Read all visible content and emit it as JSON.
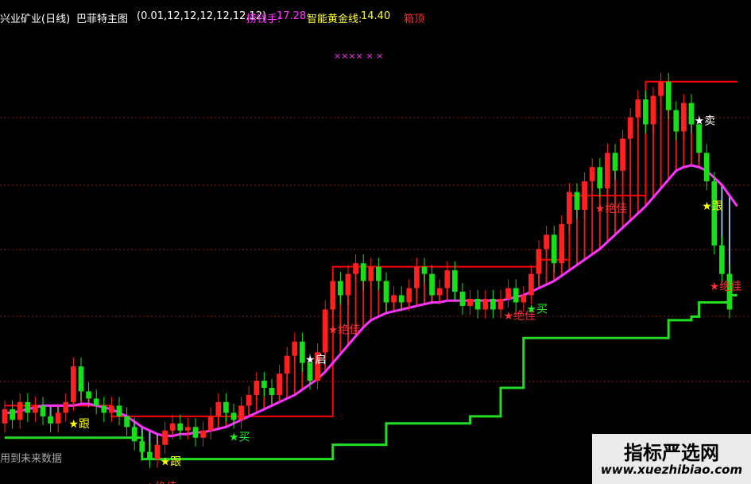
{
  "header": {
    "stock_name": "兴业矿业(日线)",
    "indicator": "巴菲特主图",
    "params": "(0.01,12,12,12,12,12,12)",
    "money_label": "捞钱手:",
    "money_value": "17.28",
    "gold_label": "智能黄金线:",
    "gold_value": "14.40",
    "box_label": "箱顶",
    "marks": "××××  ×      ×"
  },
  "signals": {
    "follow": "★跟",
    "buy": "★买",
    "sell": "★卖",
    "best": "★绝佳",
    "start": "★启"
  },
  "footer_note": "用到未来数据",
  "watermark": {
    "title": "指标严选网",
    "url": "www.xuezhibiao.com"
  },
  "colors": {
    "up": "#ff2020",
    "down": "#18e018",
    "resistance": "#ff0000",
    "support": "#22dd22",
    "trend": "#ff33ff",
    "fill_up": "#ff2020",
    "fill_down": "#9fd6ff",
    "signal_white": "#ffffff",
    "signal_yellow": "#ffff00",
    "signal_red": "#ff3030",
    "signal_green": "#22ee22",
    "signal_magenta": "#ff33ff",
    "header_text": "#ffffff",
    "header_red": "#ff2a2a",
    "header_magenta": "#ff33ff",
    "header_yellow": "#ffff33"
  },
  "chart_data": {
    "type": "candlestick",
    "title": "兴业矿业(日线) 巴菲特主图",
    "grid": true,
    "candles": [
      {
        "o": 8.0,
        "c": 8.4
      },
      {
        "o": 8.4,
        "c": 8.1
      },
      {
        "o": 8.1,
        "c": 8.6
      },
      {
        "o": 8.6,
        "c": 8.3
      },
      {
        "o": 8.3,
        "c": 8.5
      },
      {
        "o": 8.5,
        "c": 8.2
      },
      {
        "o": 8.2,
        "c": 8.0
      },
      {
        "o": 8.0,
        "c": 8.3
      },
      {
        "o": 8.3,
        "c": 8.6
      },
      {
        "o": 8.6,
        "c": 9.6
      },
      {
        "o": 9.6,
        "c": 8.9
      },
      {
        "o": 8.9,
        "c": 8.7
      },
      {
        "o": 8.7,
        "c": 8.5
      },
      {
        "o": 8.5,
        "c": 8.3
      },
      {
        "o": 8.3,
        "c": 8.5
      },
      {
        "o": 8.5,
        "c": 8.2
      },
      {
        "o": 8.2,
        "c": 7.9
      },
      {
        "o": 7.9,
        "c": 7.5
      },
      {
        "o": 7.5,
        "c": 7.2
      },
      {
        "o": 7.2,
        "c": 7.0
      },
      {
        "o": 7.0,
        "c": 7.4
      },
      {
        "o": 7.4,
        "c": 7.8
      },
      {
        "o": 7.8,
        "c": 8.0
      },
      {
        "o": 8.0,
        "c": 7.8
      },
      {
        "o": 7.8,
        "c": 7.9
      },
      {
        "o": 7.9,
        "c": 7.6
      },
      {
        "o": 7.6,
        "c": 7.8
      },
      {
        "o": 7.8,
        "c": 8.2
      },
      {
        "o": 8.2,
        "c": 8.6
      },
      {
        "o": 8.6,
        "c": 8.3
      },
      {
        "o": 8.3,
        "c": 8.1
      },
      {
        "o": 8.1,
        "c": 8.5
      },
      {
        "o": 8.5,
        "c": 8.8
      },
      {
        "o": 8.8,
        "c": 9.2
      },
      {
        "o": 9.2,
        "c": 9.0
      },
      {
        "o": 9.0,
        "c": 8.8
      },
      {
        "o": 8.8,
        "c": 9.4
      },
      {
        "o": 9.4,
        "c": 9.9
      },
      {
        "o": 9.9,
        "c": 10.3
      },
      {
        "o": 10.3,
        "c": 9.7
      },
      {
        "o": 9.7,
        "c": 9.2
      },
      {
        "o": 9.2,
        "c": 10.0
      },
      {
        "o": 10.0,
        "c": 11.2
      },
      {
        "o": 11.2,
        "c": 12.0
      },
      {
        "o": 12.0,
        "c": 11.6
      },
      {
        "o": 11.6,
        "c": 12.2
      },
      {
        "o": 12.2,
        "c": 12.5
      },
      {
        "o": 12.5,
        "c": 12.0
      },
      {
        "o": 12.0,
        "c": 12.4
      },
      {
        "o": 12.4,
        "c": 12.0
      },
      {
        "o": 12.0,
        "c": 11.4
      },
      {
        "o": 11.4,
        "c": 11.6
      },
      {
        "o": 11.6,
        "c": 11.4
      },
      {
        "o": 11.4,
        "c": 11.8
      },
      {
        "o": 11.8,
        "c": 12.4
      },
      {
        "o": 12.4,
        "c": 12.2
      },
      {
        "o": 12.2,
        "c": 11.6
      },
      {
        "o": 11.6,
        "c": 11.8
      },
      {
        "o": 11.8,
        "c": 12.3
      },
      {
        "o": 12.3,
        "c": 11.7
      },
      {
        "o": 11.7,
        "c": 11.3
      },
      {
        "o": 11.3,
        "c": 11.5
      },
      {
        "o": 11.5,
        "c": 11.2
      },
      {
        "o": 11.2,
        "c": 11.5
      },
      {
        "o": 11.5,
        "c": 11.2
      },
      {
        "o": 11.2,
        "c": 11.5
      },
      {
        "o": 11.5,
        "c": 11.8
      },
      {
        "o": 11.8,
        "c": 11.4
      },
      {
        "o": 11.4,
        "c": 11.6
      },
      {
        "o": 11.6,
        "c": 12.2
      },
      {
        "o": 12.2,
        "c": 12.9
      },
      {
        "o": 12.9,
        "c": 13.3
      },
      {
        "o": 13.3,
        "c": 12.5
      },
      {
        "o": 12.5,
        "c": 13.6
      },
      {
        "o": 13.6,
        "c": 14.5
      },
      {
        "o": 14.5,
        "c": 14.0
      },
      {
        "o": 14.0,
        "c": 14.8
      },
      {
        "o": 14.8,
        "c": 15.2
      },
      {
        "o": 15.2,
        "c": 14.6
      },
      {
        "o": 14.6,
        "c": 15.6
      },
      {
        "o": 15.6,
        "c": 15.1
      },
      {
        "o": 15.1,
        "c": 16.0
      },
      {
        "o": 16.0,
        "c": 16.6
      },
      {
        "o": 16.6,
        "c": 17.1
      },
      {
        "o": 17.1,
        "c": 16.4
      },
      {
        "o": 16.4,
        "c": 17.2
      },
      {
        "o": 17.2,
        "c": 17.6
      },
      {
        "o": 17.6,
        "c": 16.8
      },
      {
        "o": 16.8,
        "c": 16.2
      },
      {
        "o": 16.2,
        "c": 17.0
      },
      {
        "o": 17.0,
        "c": 16.4
      },
      {
        "o": 16.4,
        "c": 15.6
      },
      {
        "o": 15.6,
        "c": 14.8
      },
      {
        "o": 14.8,
        "c": 13.0
      },
      {
        "o": 13.0,
        "c": 12.2
      },
      {
        "o": 12.2,
        "c": 11.2
      }
    ],
    "resistance": [
      8.5,
      8.5,
      8.5,
      8.5,
      8.5,
      8.5,
      8.5,
      8.5,
      8.5,
      8.5,
      8.5,
      8.5,
      8.5,
      8.5,
      8.2,
      8.2,
      8.2,
      8.2,
      8.2,
      8.2,
      8.2,
      8.2,
      8.2,
      8.2,
      8.2,
      8.2,
      8.2,
      8.2,
      8.2,
      8.2,
      8.2,
      8.2,
      8.2,
      8.2,
      8.2,
      8.2,
      8.2,
      8.2,
      8.2,
      8.2,
      8.2,
      8.2,
      8.2,
      12.4,
      12.4,
      12.4,
      12.4,
      12.4,
      12.4,
      12.4,
      12.4,
      12.4,
      12.4,
      12.4,
      12.4,
      12.4,
      12.4,
      12.4,
      12.4,
      12.4,
      12.4,
      12.4,
      12.4,
      12.4,
      12.4,
      12.4,
      12.4,
      12.4,
      12.4,
      12.4,
      12.6,
      12.6,
      12.6,
      12.6,
      14.4,
      14.4,
      14.4,
      14.4,
      14.4,
      14.4,
      14.4,
      14.4,
      14.4,
      14.4,
      17.6,
      17.6,
      17.6,
      17.6,
      17.6,
      17.6,
      17.6,
      17.6,
      17.6,
      17.6,
      17.6,
      17.6,
      17.6
    ],
    "support": [
      7.6,
      7.6,
      7.6,
      7.6,
      7.6,
      7.6,
      7.6,
      7.6,
      7.6,
      7.6,
      7.6,
      7.6,
      7.6,
      7.6,
      7.6,
      7.6,
      7.6,
      7.6,
      7.0,
      7.0,
      7.0,
      7.0,
      7.0,
      7.0,
      7.0,
      7.0,
      7.0,
      7.0,
      7.0,
      7.0,
      7.0,
      7.0,
      7.0,
      7.0,
      7.0,
      7.0,
      7.0,
      7.0,
      7.0,
      7.0,
      7.0,
      7.0,
      7.0,
      7.4,
      7.4,
      7.4,
      7.4,
      7.4,
      7.4,
      7.4,
      8.0,
      8.0,
      8.0,
      8.0,
      8.0,
      8.0,
      8.0,
      8.0,
      8.0,
      8.0,
      8.0,
      8.2,
      8.2,
      8.2,
      8.2,
      9.0,
      9.0,
      9.0,
      10.4,
      10.4,
      10.4,
      10.4,
      10.4,
      10.4,
      10.4,
      10.4,
      10.4,
      10.4,
      10.4,
      10.4,
      10.4,
      10.4,
      10.4,
      10.4,
      10.4,
      10.4,
      10.4,
      10.9,
      10.9,
      10.9,
      11.0,
      11.4,
      11.4,
      11.4,
      11.4,
      11.6,
      11.6
    ],
    "trend": [
      8.3,
      8.3,
      8.35,
      8.4,
      8.45,
      8.5,
      8.5,
      8.5,
      8.5,
      8.5,
      8.55,
      8.55,
      8.5,
      8.45,
      8.4,
      8.3,
      8.2,
      8.05,
      7.9,
      7.8,
      7.7,
      7.65,
      7.65,
      7.7,
      7.7,
      7.75,
      7.75,
      7.8,
      7.85,
      7.9,
      8.0,
      8.1,
      8.2,
      8.3,
      8.4,
      8.5,
      8.6,
      8.7,
      8.8,
      8.95,
      9.1,
      9.25,
      9.45,
      9.7,
      9.95,
      10.2,
      10.45,
      10.7,
      10.9,
      11.0,
      11.1,
      11.15,
      11.2,
      11.25,
      11.3,
      11.35,
      11.4,
      11.4,
      11.45,
      11.45,
      11.45,
      11.45,
      11.45,
      11.45,
      11.45,
      11.45,
      11.5,
      11.55,
      11.6,
      11.7,
      11.8,
      11.9,
      12.0,
      12.15,
      12.3,
      12.45,
      12.6,
      12.75,
      12.9,
      13.1,
      13.3,
      13.5,
      13.7,
      13.9,
      14.1,
      14.35,
      14.6,
      14.85,
      15.1,
      15.2,
      15.25,
      15.2,
      15.1,
      14.9,
      14.7,
      14.4,
      14.1
    ],
    "ylim": [
      6.5,
      19.0
    ],
    "ylabel": "",
    "xlabel": ""
  }
}
